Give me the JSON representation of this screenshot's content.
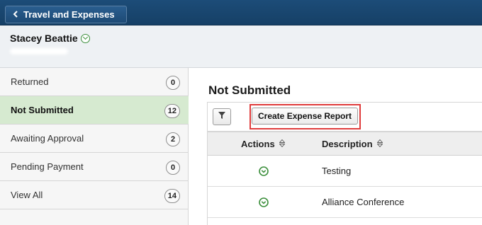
{
  "header": {
    "back_label": "Travel and Expenses"
  },
  "user": {
    "name": "Stacey Beattie"
  },
  "sidebar": {
    "items": [
      {
        "label": "Returned",
        "count": "0",
        "active": false
      },
      {
        "label": "Not Submitted",
        "count": "12",
        "active": true
      },
      {
        "label": "Awaiting Approval",
        "count": "2",
        "active": false
      },
      {
        "label": "Pending Payment",
        "count": "0",
        "active": false
      },
      {
        "label": "View All",
        "count": "14",
        "active": false
      }
    ]
  },
  "main": {
    "title": "Not Submitted",
    "toolbar": {
      "create_label": "Create Expense Report"
    },
    "columns": {
      "actions": "Actions",
      "description": "Description"
    },
    "rows": [
      {
        "description": "Testing"
      },
      {
        "description": "Alliance Conference"
      }
    ]
  },
  "colors": {
    "banner": "#1c4c78",
    "active_nav": "#d6ead0",
    "highlight": "#e03c3c",
    "action_icon": "#3c8f3c"
  }
}
